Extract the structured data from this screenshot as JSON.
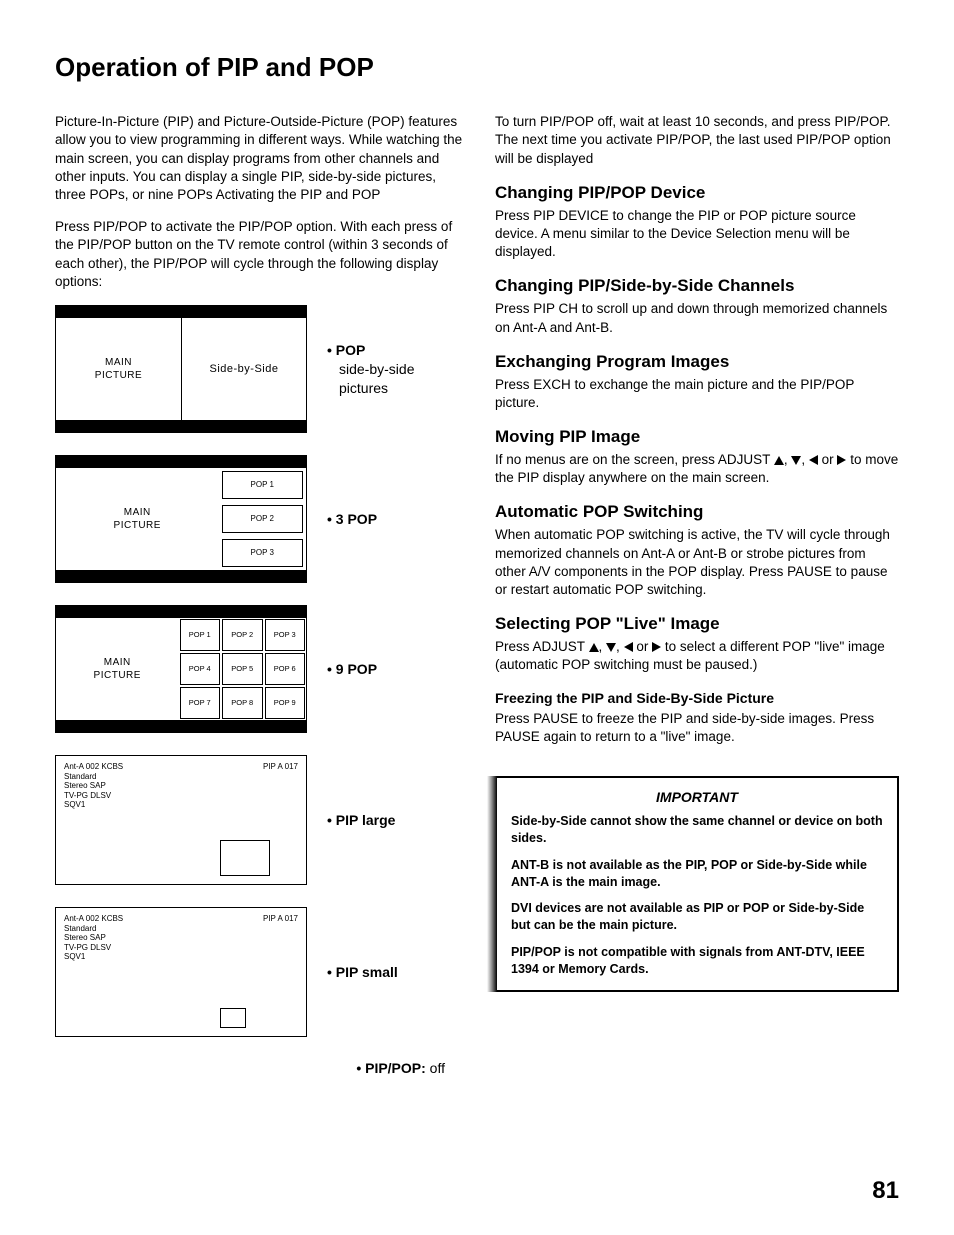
{
  "title": "Operation of PIP and POP",
  "intro1": "Picture-In-Picture (PIP) and Picture-Outside-Picture (POP) features allow you to view programming in different ways.  While watching the main screen, you can display programs from other channels and other inputs.  You can display a single PIP, side-by-side pictures, three POPs, or nine POPs Activating the PIP and POP",
  "intro2": "Press PIP/POP to activate the PIP/POP option.  With each press of the PIP/POP button on the TV remote control (within 3 seconds of each other), the PIP/POP will cycle through the following display options:",
  "diagrams": {
    "sbs": {
      "main": "MAIN\nPICTURE",
      "right": "Side-by-Side",
      "label_bold": "• POP",
      "label_rest": "side-by-side pictures"
    },
    "pop3": {
      "main": "MAIN\nPICTURE",
      "pops": [
        "POP 1",
        "POP 2",
        "POP 3"
      ],
      "label": "• 3 POP"
    },
    "pop9": {
      "main": "MAIN\nPICTURE",
      "pops": [
        "POP 1",
        "POP 2",
        "POP 3",
        "POP 4",
        "POP 5",
        "POP 6",
        "POP 7",
        "POP 8",
        "POP 9"
      ],
      "label": "• 9 POP"
    },
    "piplarge": {
      "osd_left": [
        "Ant-A 002 KCBS",
        "Standard",
        "Stereo SAP",
        "TV-PG DLSV",
        "SQV1"
      ],
      "osd_right": "PIP A 017",
      "label": "• PIP large"
    },
    "pipsmall": {
      "osd_left": [
        "Ant-A 002 KCBS",
        "Standard",
        "Stereo SAP",
        "TV-PG DLSV",
        "SQV1"
      ],
      "osd_right": "PIP A 017",
      "label": "• PIP small"
    },
    "off": {
      "label_b": "• PIP/POP:",
      "label_r": " off"
    }
  },
  "right": {
    "p0": "To turn PIP/POP off, wait at least 10 seconds, and press PIP/POP.  The next time you activate PIP/POP, the last used PIP/POP option will be displayed",
    "h1": "Changing PIP/POP Device",
    "p1": "Press PIP DEVICE to change the PIP or POP picture source device.  A menu similar to the Device Selection menu will be displayed.",
    "h2": "Changing PIP/Side-by-Side Channels",
    "p2": "Press PIP CH to scroll up and down through memorized channels on Ant-A and Ant-B.",
    "h3": "Exchanging Program Images",
    "p3": "Press EXCH to exchange the main picture and the PIP/POP picture.",
    "h4": "Moving PIP Image",
    "p4a": "If no menus are on the screen, press ADJUST ",
    "p4b": " to move the PIP display anywhere on the main screen.",
    "h5": "Automatic POP Switching",
    "p5": "When automatic POP switching is active, the TV will cycle through memorized channels on Ant-A or Ant-B or strobe pictures from other A/V components in the POP display.  Press PAUSE to pause or restart automatic POP switching.",
    "h6": "Selecting POP \"Live\" Image",
    "p6a": "Press ADJUST ",
    "p6b": " to select a different POP \"live\" image (automatic POP switching must be paused.)",
    "h7": "Freezing the PIP and Side-By-Side Picture",
    "p7": "Press PAUSE to freeze the PIP and side-by-side images.  Press PAUSE again to return to a \"live\" image."
  },
  "important": {
    "title": "IMPORTANT",
    "i1": "Side-by-Side cannot show the same channel or device on both sides.",
    "i2": "ANT-B is not available as the PIP, POP or Side-by-Side while ANT-A is the main image.",
    "i3": "DVI devices are not available as PIP or POP or Side-by-Side but can be the main picture.",
    "i4": "PIP/POP is not compatible with signals from ANT-DTV, IEEE 1394 or Memory Cards."
  },
  "page": "81"
}
